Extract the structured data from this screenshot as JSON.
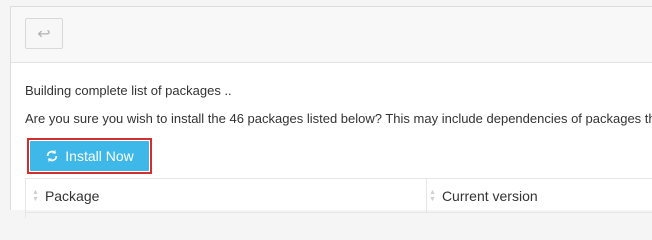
{
  "toolbar": {
    "back_icon": "↩"
  },
  "messages": {
    "line1": "Building complete list of packages ..",
    "line2": "Are you sure you wish to install the 46 packages listed below? This may include dependencies of packages th"
  },
  "actions": {
    "install_label": "Install Now",
    "install_color": "#3db8e8",
    "highlight_color": "#d32f2f"
  },
  "table": {
    "columns": [
      "Package",
      "Current version"
    ]
  }
}
